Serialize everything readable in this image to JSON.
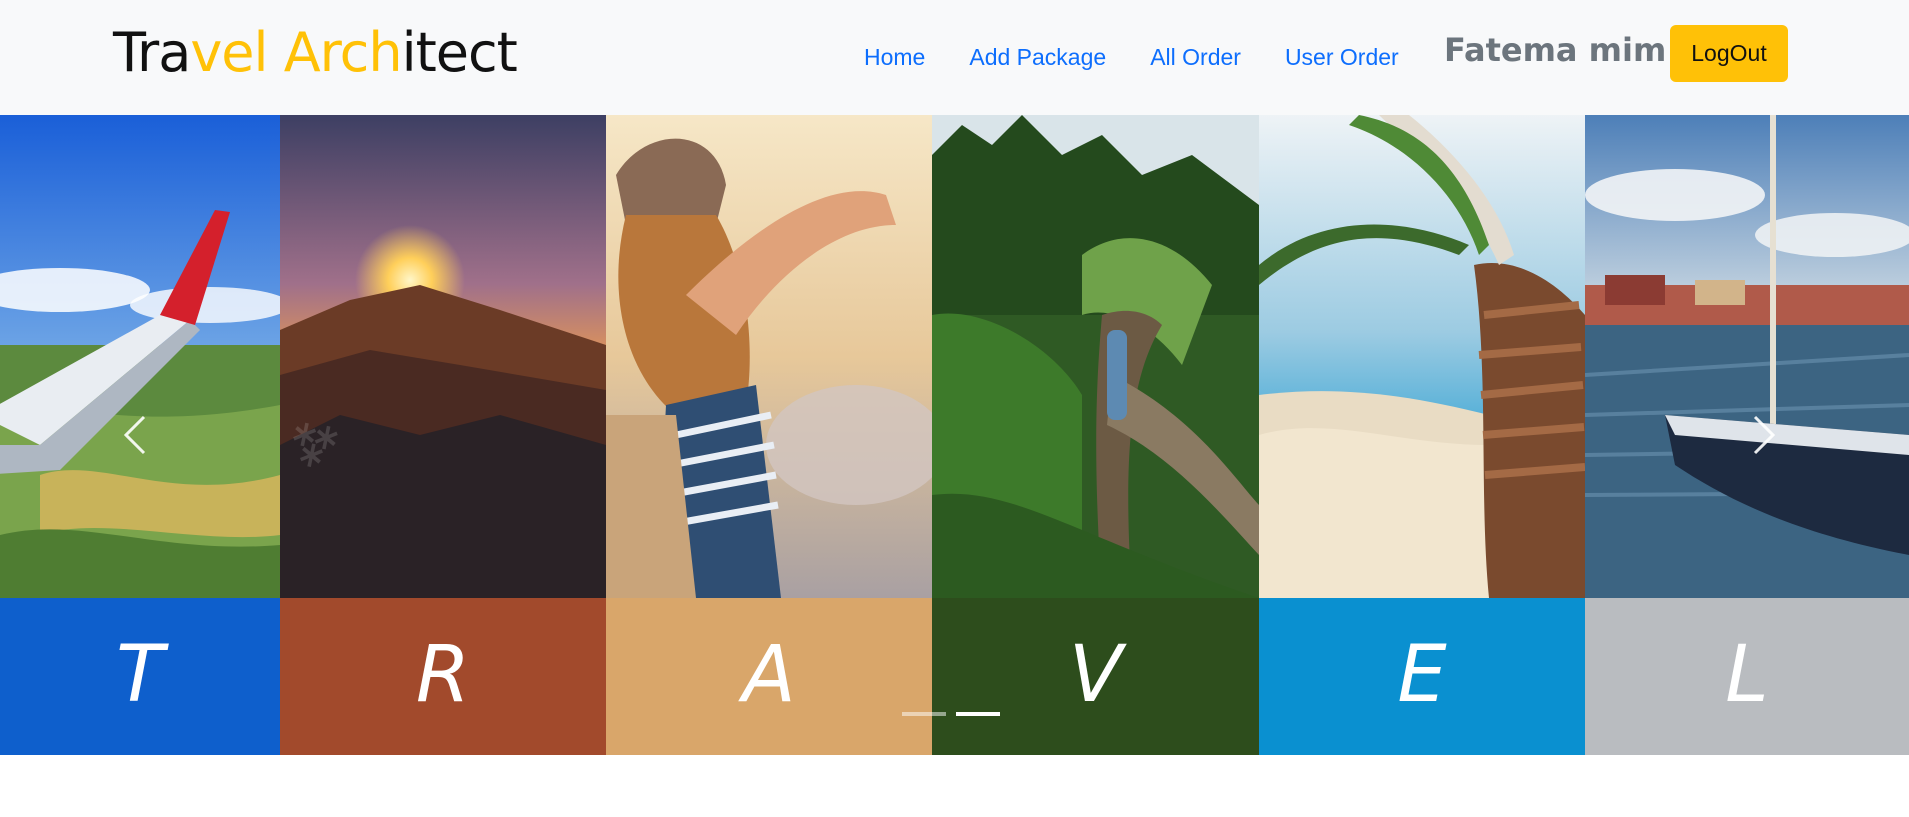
{
  "navbar": {
    "brand_parts": [
      "Tra",
      "vel Arch",
      "itect"
    ],
    "links": [
      {
        "label": "Home"
      },
      {
        "label": "Add Package"
      },
      {
        "label": "All Order"
      },
      {
        "label": "User Order"
      }
    ],
    "username": "Fatema mim",
    "logout_label": "LogOut"
  },
  "carousel": {
    "panels": [
      {
        "letter": "T",
        "band_color": "#0e5fcc",
        "scene": "airplane-wing"
      },
      {
        "letter": "R",
        "band_color": "#a24a2c",
        "scene": "mountain-sunset"
      },
      {
        "letter": "A",
        "band_color": "#d9a66a",
        "scene": "traveler-woman"
      },
      {
        "letter": "V",
        "band_color": "#2d4d1c",
        "scene": "forest-train"
      },
      {
        "letter": "E",
        "band_color": "#0a90d0",
        "scene": "palm-beach"
      },
      {
        "letter": "L",
        "band_color": "#b9bcc0",
        "scene": "sailboat-harbor"
      }
    ],
    "prev_icon": "chevron-left-icon",
    "next_icon": "chevron-right-icon",
    "active_slide": 2,
    "slide_count": 2
  },
  "colors": {
    "brand_dark": "#111111",
    "brand_accent": "#ffc107",
    "link": "#0d6efd",
    "username": "#6c757d",
    "navbar_bg": "#f8f9fa"
  }
}
